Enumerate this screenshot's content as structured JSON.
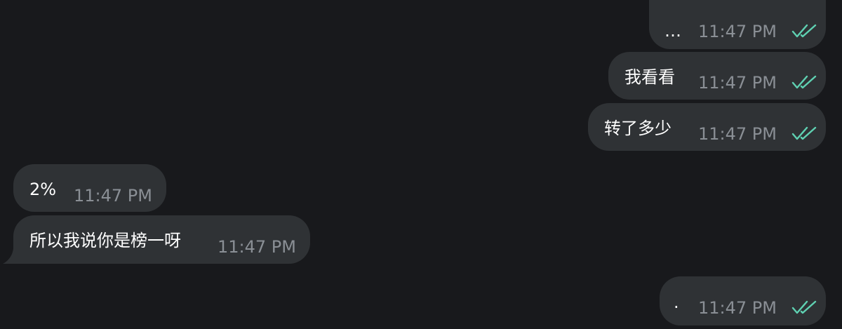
{
  "colors": {
    "background": "#18191c",
    "bubble": "#2f3235",
    "text": "#ffffff",
    "timestamp": "#8a8f95",
    "read_check": "#5fd1b2"
  },
  "messages": [
    {
      "direction": "outgoing",
      "text": "…",
      "time": "11:47 PM",
      "status_icon": "double-check-icon"
    },
    {
      "direction": "outgoing",
      "text": "我看看",
      "time": "11:47 PM",
      "status_icon": "double-check-icon"
    },
    {
      "direction": "outgoing",
      "text": "转了多少",
      "time": "11:47 PM",
      "status_icon": "double-check-icon"
    },
    {
      "direction": "incoming",
      "text": "2%",
      "time": "11:47 PM"
    },
    {
      "direction": "incoming",
      "text": "所以我说你是榜一呀",
      "time": "11:47 PM"
    },
    {
      "direction": "outgoing",
      "text": "·",
      "time": "11:47 PM",
      "status_icon": "double-check-icon"
    }
  ]
}
